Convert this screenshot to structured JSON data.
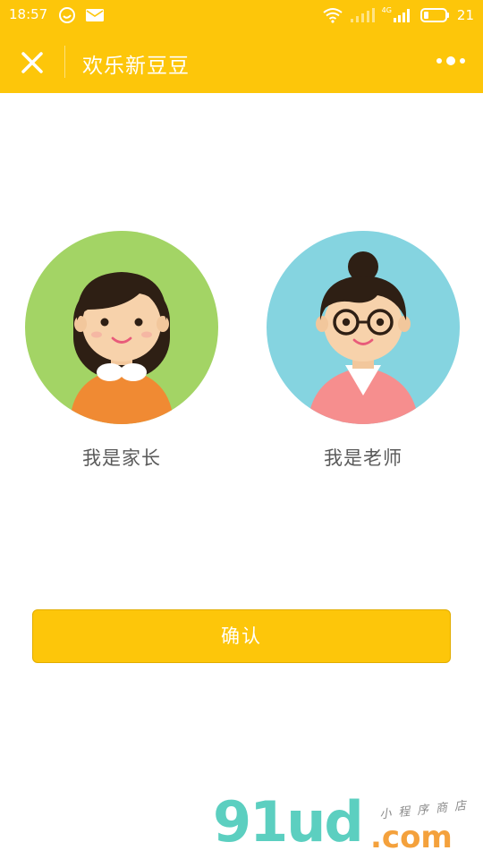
{
  "status_bar": {
    "time": "18:57",
    "battery_level": "21",
    "network_label": "4G",
    "icons": [
      "message-bubble-icon",
      "mail-icon",
      "wifi-icon",
      "signal-empty-icon",
      "signal-4g-icon",
      "battery-icon"
    ]
  },
  "nav": {
    "title": "欢乐新豆豆",
    "close_icon": "close-icon",
    "more_icon": "more-dots-icon"
  },
  "roles": [
    {
      "label": "我是家长",
      "avatar": "girl-avatar",
      "bg": "#a3d465"
    },
    {
      "label": "我是老师",
      "avatar": "teacher-avatar",
      "bg": "#85d4e0"
    }
  ],
  "confirm_label": "确认",
  "watermark": {
    "brand": "91ud",
    "domain": ".com",
    "tagline": "小程序商店"
  },
  "colors": {
    "accent": "#fdc60a",
    "text_gray": "#5a5a5a",
    "watermark_teal": "#5ccfc0",
    "watermark_orange": "#f4a13c"
  }
}
